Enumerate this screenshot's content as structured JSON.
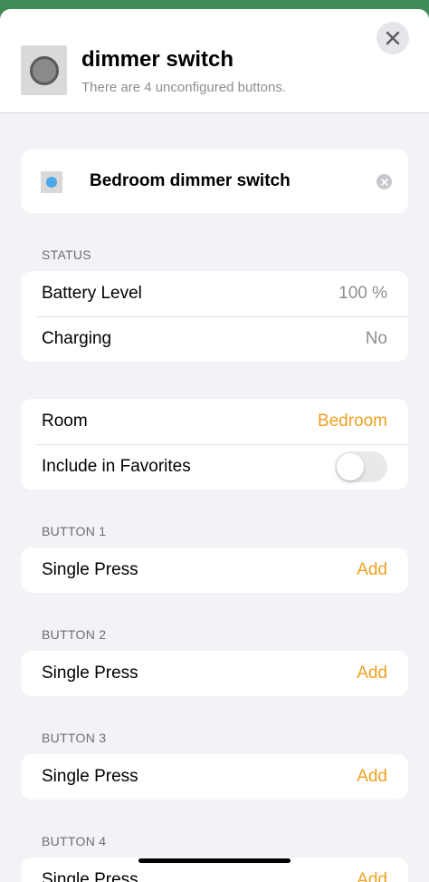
{
  "header": {
    "title": "dimmer switch",
    "subtitle": "There are 4 unconfigured buttons.",
    "close_icon": "close-icon"
  },
  "accessory": {
    "name": "Bedroom dimmer switch",
    "clear_icon": "clear-icon"
  },
  "status": {
    "label": "STATUS",
    "rows": [
      {
        "label": "Battery Level",
        "value": "100 %"
      },
      {
        "label": "Charging",
        "value": "No"
      }
    ]
  },
  "settings": {
    "room_label": "Room",
    "room_value": "Bedroom",
    "favorites_label": "Include in Favorites",
    "favorites_on": false
  },
  "buttons": [
    {
      "section": "BUTTON 1",
      "action": "Single Press",
      "add": "Add"
    },
    {
      "section": "BUTTON 2",
      "action": "Single Press",
      "add": "Add"
    },
    {
      "section": "BUTTON 3",
      "action": "Single Press",
      "add": "Add"
    },
    {
      "section": "BUTTON 4",
      "action": "Single Press",
      "add": "Add"
    }
  ],
  "colors": {
    "accent": "#f0a020",
    "background": "#f2f2f7",
    "secondary_text": "#8e8e93"
  }
}
